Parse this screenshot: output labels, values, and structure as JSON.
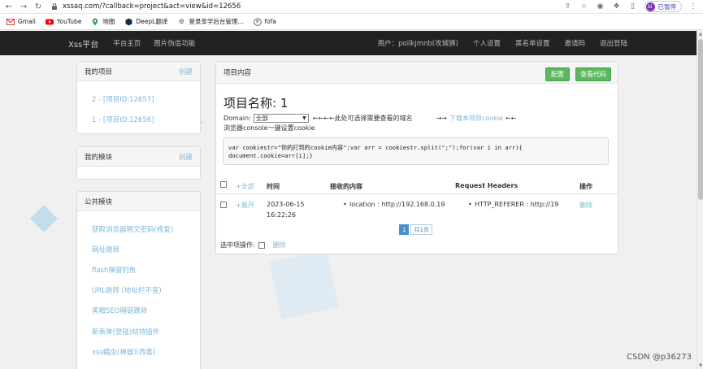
{
  "browser": {
    "url": "xssaq.com/?callback=project&act=view&id=12656",
    "profile_initial": "ki",
    "profile_status": "已暂停"
  },
  "bookmarks": [
    {
      "label": "Gmail",
      "icon": "gmail-icon"
    },
    {
      "label": "YouTube",
      "icon": "youtube-icon"
    },
    {
      "label": "地图",
      "icon": "maps-icon"
    },
    {
      "label": "DeepL翻译",
      "icon": "deepl-icon"
    },
    {
      "label": "登录享学后台管理...",
      "icon": "tool-icon"
    },
    {
      "label": "fofa",
      "icon": "fofa-icon"
    }
  ],
  "nav": {
    "brand": "Xss平台",
    "home": "平台主页",
    "image_phishing": "图片伪造功能",
    "user": "用户：poilkjmnb(攻城狮)",
    "settings": "个人设置",
    "blacklist": "黑名单设置",
    "invite": "邀请码",
    "logout": "退出登陆"
  },
  "sidebar": {
    "projects_title": "我的项目",
    "create_label": "创建",
    "projects": [
      "2 - [项目ID:12657]",
      "1 - [项目ID:12656]"
    ],
    "modules_title": "我的模块",
    "public_title": "公共模块",
    "public_modules": [
      "获取浏览器明文密码(修复)",
      "网址跳转",
      "flash弹窗钓鱼",
      "URL跳转 (地址栏不变)",
      "黑帽SEO暗链跳转",
      "新表单(登陆)劫持插件",
      "xss蠕虫(神器)(西毒)"
    ]
  },
  "main": {
    "panel_title": "项目内容",
    "config_btn": "配置",
    "view_code_btn": "查看代码",
    "project_name": "项目名称: 1",
    "domain_label": "Domain:",
    "domain_value": "全部",
    "domain_hint": "←←←←此处可选择需要查看的域名",
    "download_prefix": "→→",
    "download_link": "下载本项目cookie",
    "download_suffix": "←←",
    "console_hint": "浏览器console一键设置cookie",
    "code": "var cookiestr=\"你的打到的cookie内容\";var arr = cookiestr.split(\";\");for(var i in arr){ document.cookie=arr[i];}",
    "table": {
      "expand_all": "+全部",
      "headers": [
        "时间",
        "接收的内容",
        "Request Headers",
        "操作"
      ],
      "rows": [
        {
          "expand": "+展开",
          "date": "2023-06-15",
          "time": "16:22:26",
          "content": "location : http://192.168.0.19",
          "headers": "HTTP_REFERER : http://19",
          "action": "删除"
        }
      ]
    },
    "pager_current": "1",
    "pager_total": "共1页",
    "bulk_label": "选中项操作:",
    "bulk_delete": "删除"
  },
  "watermark": "CSDN @p36273"
}
